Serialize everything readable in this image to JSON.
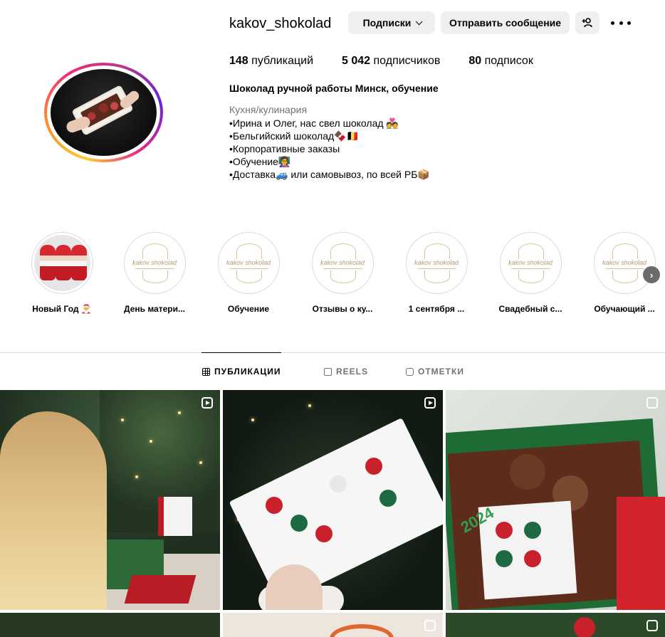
{
  "profile": {
    "username": "kakov_shokolad",
    "follow_button": "Подписки",
    "message_button": "Отправить сообщение",
    "stats": {
      "posts_count": "148",
      "posts_label": "публикаций",
      "followers_count": "5 042",
      "followers_label": "подписчиков",
      "following_count": "80",
      "following_label": "подписок"
    },
    "bio": {
      "name": "Шоколад ручной работы Минск, обучение",
      "category": "Кухня/кулинария",
      "lines": [
        "•Ирина и Олег, нас свел шоколад 💑",
        "•Бельгийский шоколад🍫🇧🇪",
        "•Корпоративные заказы",
        "•Обучение👩‍🏫",
        "•Доставка🚙 или самовывоз, по всей РБ📦"
      ]
    }
  },
  "highlights": [
    {
      "label": "Новый Год 🎅"
    },
    {
      "label": "День матери..."
    },
    {
      "label": "Обучение"
    },
    {
      "label": "Отзывы о ку..."
    },
    {
      "label": "1 сентября ..."
    },
    {
      "label": "Свадебный с..."
    },
    {
      "label": "Обучающий ..."
    }
  ],
  "highlight_logo_text": "kakov shokolad",
  "tabs": [
    {
      "label": "ПУБЛИКАЦИИ",
      "icon": "grid-icon",
      "active": true
    },
    {
      "label": "REELS",
      "icon": "reels-icon",
      "active": false
    },
    {
      "label": "ОТМЕТКИ",
      "icon": "tagged-icon",
      "active": false
    }
  ],
  "posts": [
    {
      "type": "reel"
    },
    {
      "type": "reel"
    },
    {
      "type": "carousel"
    },
    {
      "type": "image"
    },
    {
      "type": "carousel"
    },
    {
      "type": "carousel"
    }
  ],
  "colors": {
    "button_bg": "#efefef",
    "muted_text": "#737373",
    "divider": "#dbdbdb"
  },
  "post_3_text": "2024"
}
